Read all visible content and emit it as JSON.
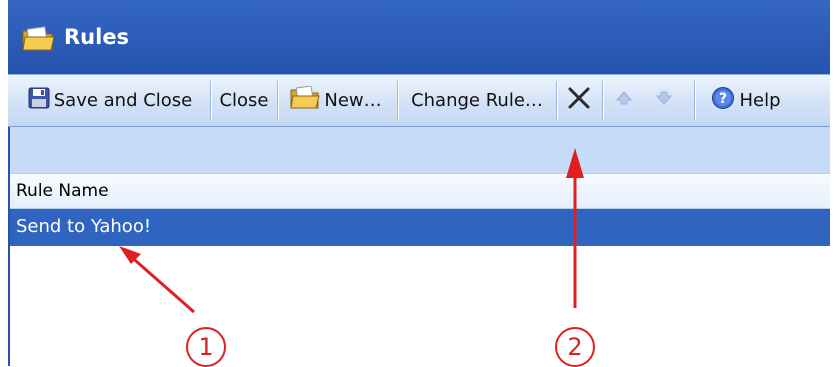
{
  "window": {
    "title": "Rules"
  },
  "toolbar": {
    "save_close": "Save and Close",
    "close": "Close",
    "new": "New…",
    "change_rule": "Change Rule…",
    "help": "Help"
  },
  "table": {
    "column_header": "Rule Name",
    "rows": [
      {
        "name": "Send to Yahoo!",
        "selected": true
      }
    ]
  },
  "annotations": [
    {
      "label": "1"
    },
    {
      "label": "2"
    }
  ],
  "colors": {
    "title_bar": "#2a5bb8",
    "toolbar": "#d3e2f7",
    "selection": "#2f64c0",
    "annotation": "#e02020"
  },
  "icons": [
    "folder-icon",
    "save-icon",
    "new-folder-icon",
    "delete-icon",
    "move-up-icon",
    "move-down-icon",
    "help-icon"
  ]
}
